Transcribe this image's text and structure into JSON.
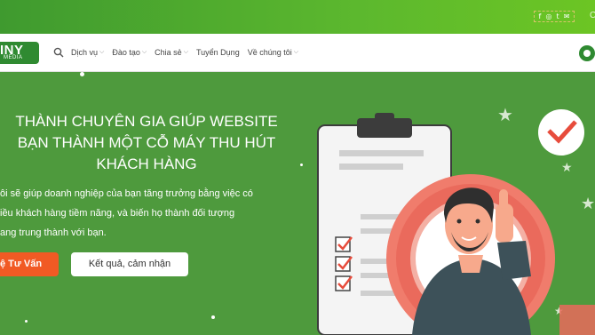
{
  "topbar": {
    "social_icons": [
      "facebook-icon",
      "instagram-icon",
      "twitter-icon",
      "email-icon"
    ],
    "social_glyphs": [
      "f",
      "◎",
      "t",
      "✉"
    ],
    "trailing_text": "C"
  },
  "logo": {
    "text": "INY",
    "subtext": "MEDIA"
  },
  "nav": {
    "items": [
      {
        "label": "Dịch vụ",
        "has_dropdown": true
      },
      {
        "label": "Đào tạo",
        "has_dropdown": true
      },
      {
        "label": "Chia sẻ",
        "has_dropdown": true
      },
      {
        "label": "Tuyển Dụng",
        "has_dropdown": false
      },
      {
        "label": "Về chúng tôi",
        "has_dropdown": true
      }
    ],
    "caret": "⌵"
  },
  "hero": {
    "headline_lines": [
      "THÀNH CHUYÊN GIA GIÚP WEBSITE",
      "BẠN THÀNH MỘT CỖ MÁY THU HÚT",
      "KHÁCH HÀNG"
    ],
    "lead_lines": [
      "ôi sẽ giúp doanh nghiệp của bạn tăng trưởng bằng việc có",
      "iều khách hàng tiềm năng, và biến họ thành đối tượng",
      "ang trung thành với bạn."
    ],
    "primary_button": "ệ Tư Vấn",
    "secondary_button": "Kết quả, cảm nhận"
  },
  "colors": {
    "topbar_green": "#5cb82e",
    "hero_green": "#4e9a3d",
    "brand_green": "#2f8a31",
    "cta_orange": "#f15a24",
    "badge_red": "#ea6a5c"
  }
}
